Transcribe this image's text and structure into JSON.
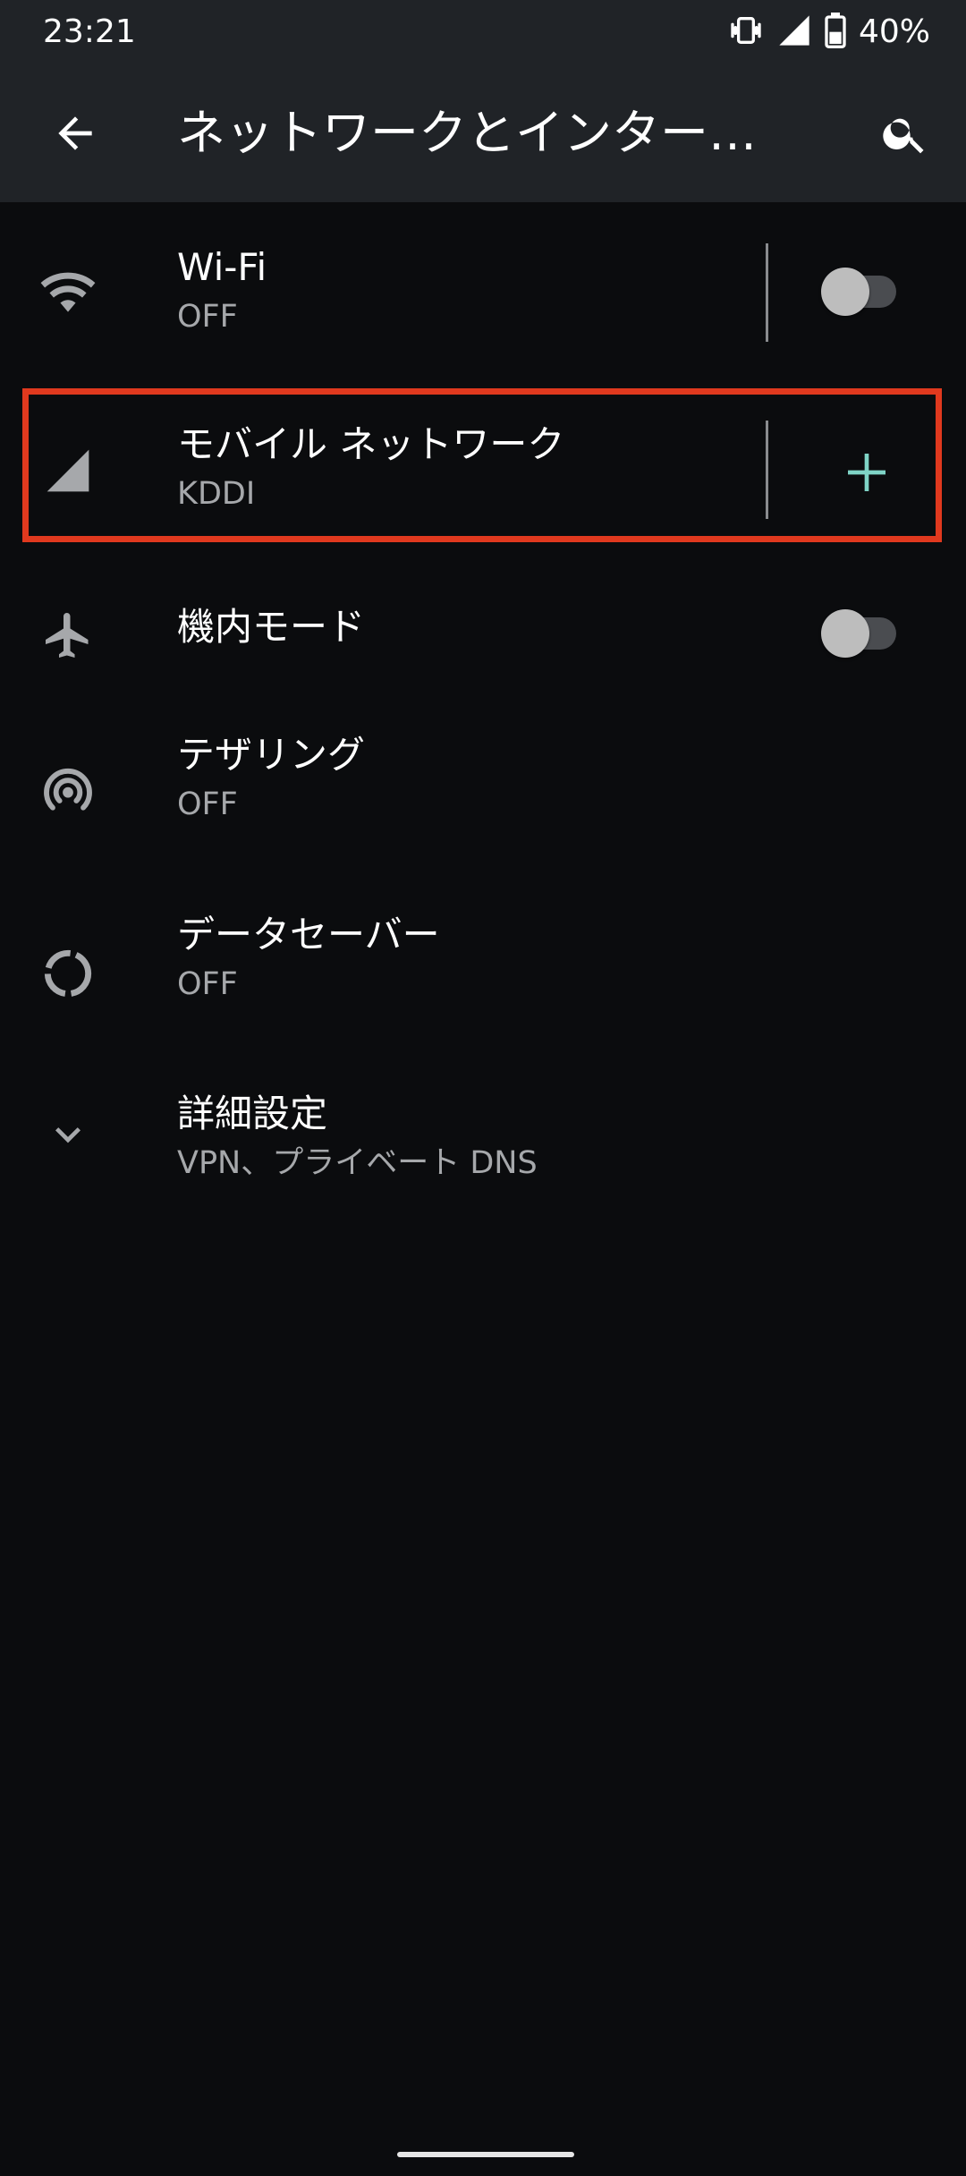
{
  "status_bar": {
    "time": "23:21",
    "battery_percent": "40%",
    "icons": [
      "vibrate-icon",
      "cellular-signal-icon",
      "battery-icon"
    ]
  },
  "app_bar": {
    "title": "ネットワークとインターネット",
    "back_icon": "arrow-back-icon",
    "search_icon": "search-icon"
  },
  "items": [
    {
      "id": "wifi",
      "label": "Wi-Fi",
      "sub": "OFF",
      "icon": "wifi-icon",
      "toggle": false
    },
    {
      "id": "mobile",
      "label": "モバイル ネットワーク",
      "sub": "KDDI",
      "icon": "cellular-signal-icon",
      "action": "add-icon",
      "highlighted": true
    },
    {
      "id": "airplane",
      "label": "機内モード",
      "icon": "airplane-icon",
      "toggle": false
    },
    {
      "id": "tethering",
      "label": "テザリング",
      "sub": "OFF",
      "icon": "hotspot-icon"
    },
    {
      "id": "datasaver",
      "label": "データセーバー",
      "sub": "OFF",
      "icon": "data-saver-icon"
    },
    {
      "id": "advanced",
      "label": "詳細設定",
      "sub": "VPN、プライベート DNS",
      "icon": "chevron-down-icon"
    }
  ],
  "colors": {
    "background": "#0b0c0e",
    "app_bar": "#202327",
    "accent": "#7fd4c6",
    "highlight_border": "#e0391e",
    "secondary_text": "#a6a8ab"
  }
}
